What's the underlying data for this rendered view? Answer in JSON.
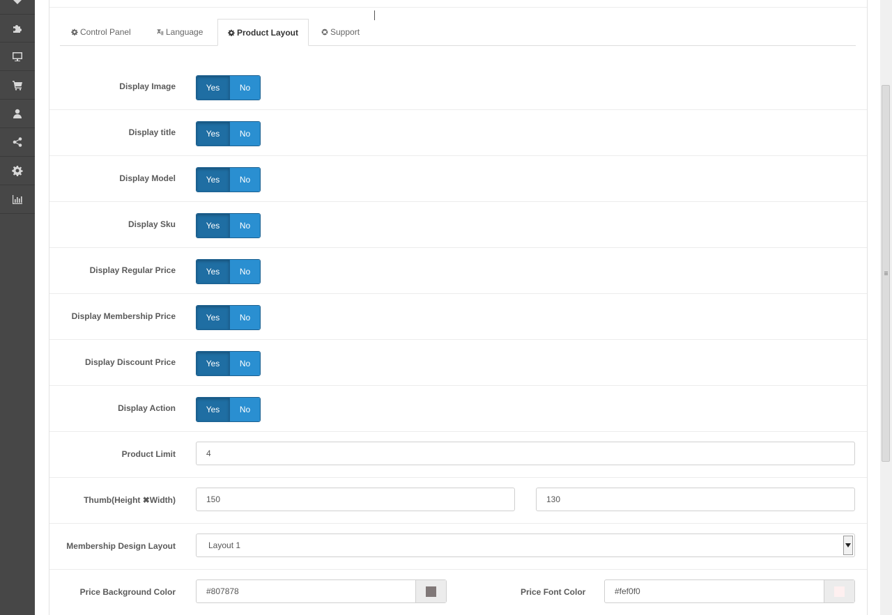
{
  "sidebar": {
    "icons": [
      "tag-icon",
      "puzzle-icon",
      "monitor-icon",
      "cart-icon",
      "user-icon",
      "share-icon",
      "gear-icon",
      "bar-chart-icon"
    ]
  },
  "tabs": [
    {
      "label": "Control Panel",
      "icon": "gear-icon",
      "active": false
    },
    {
      "label": "Language",
      "icon": "language-icon",
      "active": false
    },
    {
      "label": "Product Layout",
      "icon": "gear-icon",
      "active": true
    },
    {
      "label": "Support",
      "icon": "lifebuoy-icon",
      "active": false
    }
  ],
  "toggles": {
    "yes_label": "Yes",
    "no_label": "No",
    "rows": [
      {
        "label": "Display Image",
        "value": "Yes"
      },
      {
        "label": "Display title",
        "value": "Yes"
      },
      {
        "label": "Display Model",
        "value": "Yes"
      },
      {
        "label": "Display Sku",
        "value": "Yes"
      },
      {
        "label": "Display Regular Price",
        "value": "Yes"
      },
      {
        "label": "Display Membership Price",
        "value": "Yes"
      },
      {
        "label": "Display Discount Price",
        "value": "Yes"
      },
      {
        "label": "Display Action",
        "value": "Yes"
      }
    ]
  },
  "product_limit": {
    "label": "Product Limit",
    "value": "4"
  },
  "thumb": {
    "label": "Thumb(Height ✖Width)",
    "height": "150",
    "width": "130"
  },
  "membership_layout": {
    "label": "Membership Design Layout",
    "value": "Layout 1"
  },
  "price_bg": {
    "label": "Price Background Color",
    "value": "#807878",
    "swatch": "#807878"
  },
  "price_font": {
    "label": "Price Font Color",
    "value": "#fef0f0",
    "swatch": "#fef0f0"
  },
  "colors": {
    "toggle_active": "#1f6ea3",
    "toggle_inactive": "#2a8fd1",
    "sidebar": "#474747"
  }
}
